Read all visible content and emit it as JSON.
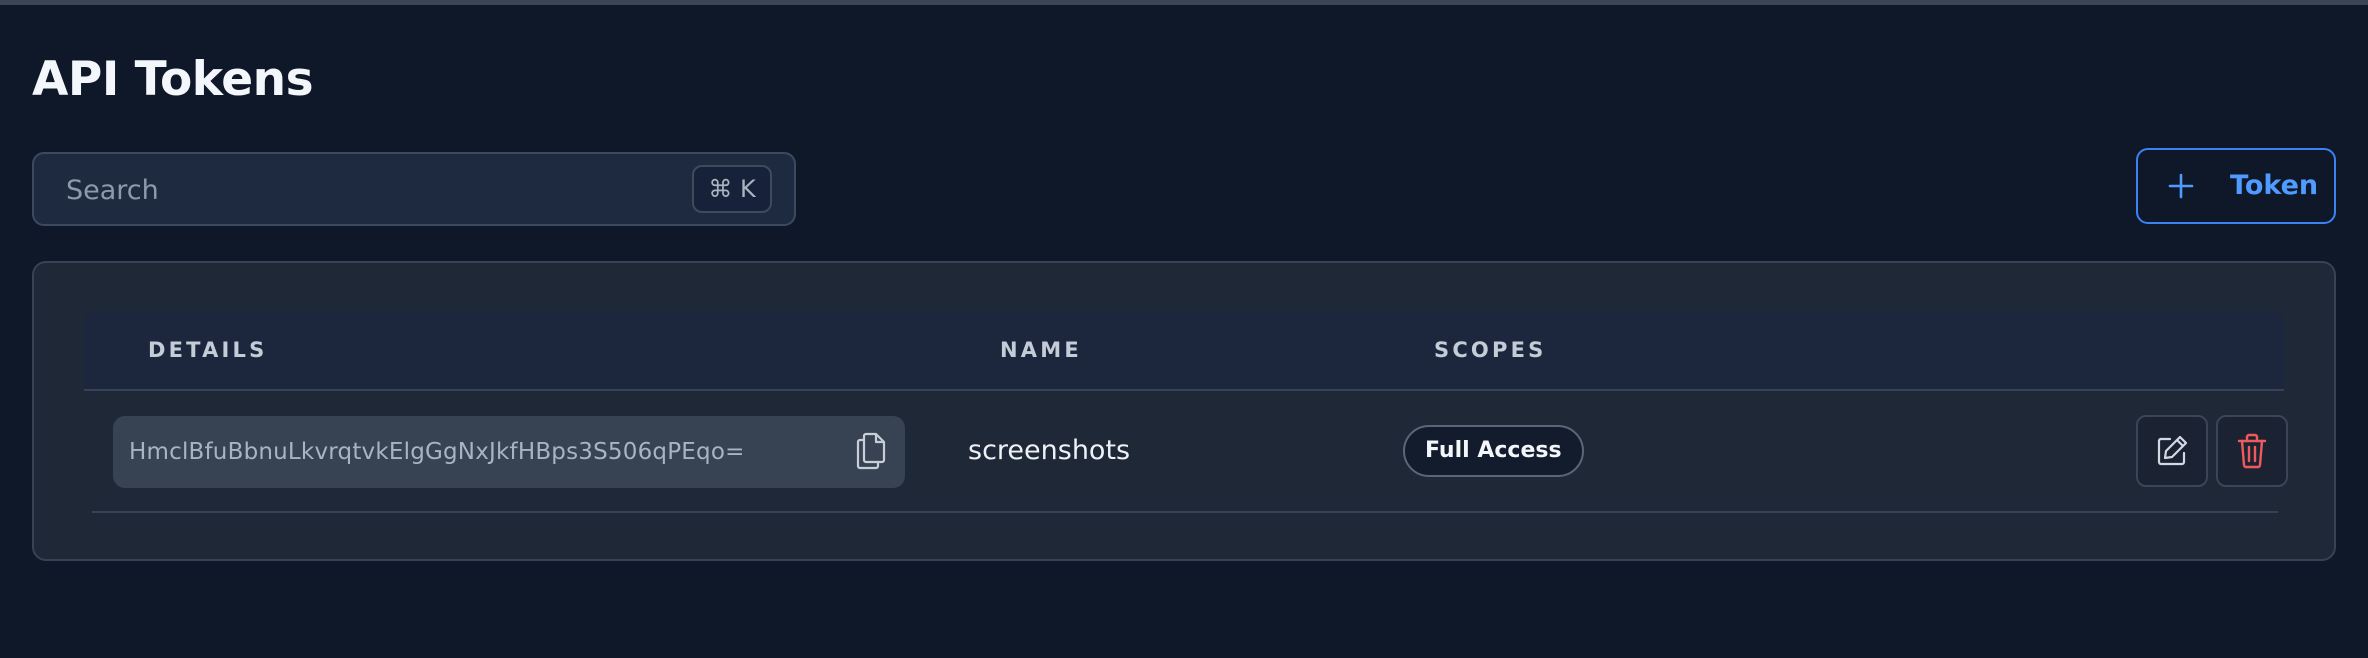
{
  "page": {
    "title": "API Tokens"
  },
  "search": {
    "placeholder": "Search",
    "value": "",
    "shortcut": "⌘ K"
  },
  "add_button": {
    "label": "Token",
    "icon": "plus-icon",
    "accent_color": "#3b82f6"
  },
  "table": {
    "columns": [
      "DETAILS",
      "NAME",
      "SCOPES"
    ],
    "rows": [
      {
        "token": "HmclBfuBbnuLkvrqtvkElgGgNxJkfHBps3S506qPEqo=",
        "name": "screenshots",
        "scope": "Full Access",
        "actions": [
          "edit-icon",
          "trash-icon"
        ]
      }
    ]
  },
  "colors": {
    "background": "#0f1828",
    "card": "#1f2837",
    "delete_icon": "#f05a5a"
  }
}
